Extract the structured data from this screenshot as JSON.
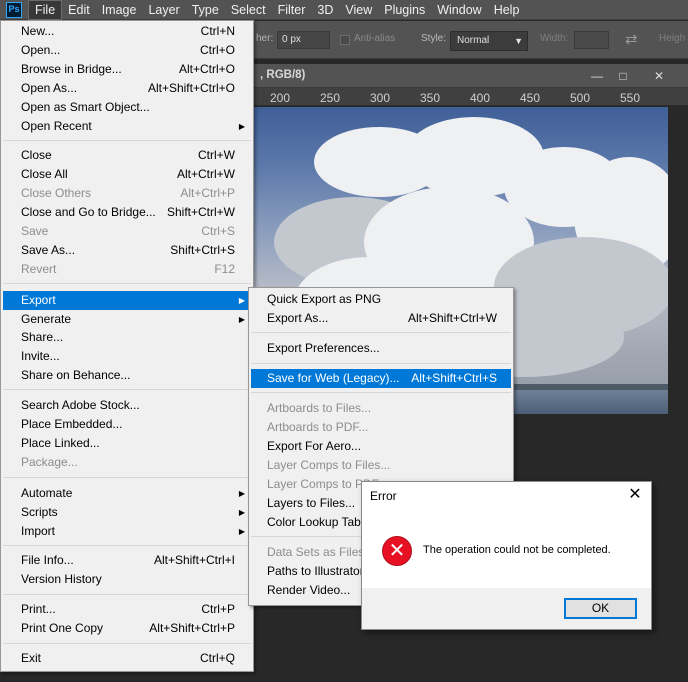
{
  "menubar": {
    "logo": "Ps",
    "items": [
      {
        "label": "File",
        "active": true
      },
      {
        "label": "Edit"
      },
      {
        "label": "Image"
      },
      {
        "label": "Layer"
      },
      {
        "label": "Type"
      },
      {
        "label": "Select"
      },
      {
        "label": "Filter"
      },
      {
        "label": "3D"
      },
      {
        "label": "View"
      },
      {
        "label": "Plugins"
      },
      {
        "label": "Window"
      },
      {
        "label": "Help"
      }
    ]
  },
  "options_bar": {
    "feather_label": "her:",
    "feather_value": "0 px",
    "antialias_label": "Anti-alias",
    "style_label": "Style:",
    "style_value": "Normal",
    "width_label": "Width:",
    "height_label": "Heigh"
  },
  "document": {
    "title_fragment": ", RGB/8)",
    "ruler_ticks": [
      "200",
      "250",
      "300",
      "350",
      "400",
      "450",
      "500",
      "550"
    ]
  },
  "file_menu": {
    "items": [
      {
        "label": "New...",
        "shortcut": "Ctrl+N"
      },
      {
        "label": "Open...",
        "shortcut": "Ctrl+O"
      },
      {
        "label": "Browse in Bridge...",
        "shortcut": "Alt+Ctrl+O"
      },
      {
        "label": "Open As...",
        "shortcut": "Alt+Shift+Ctrl+O"
      },
      {
        "label": "Open as Smart Object...",
        "shortcut": ""
      },
      {
        "label": "Open Recent",
        "shortcut": "",
        "submenu": true
      },
      {
        "label": "Close",
        "shortcut": "Ctrl+W"
      },
      {
        "label": "Close All",
        "shortcut": "Alt+Ctrl+W"
      },
      {
        "label": "Close Others",
        "shortcut": "Alt+Ctrl+P",
        "disabled": true
      },
      {
        "label": "Close and Go to Bridge...",
        "shortcut": "Shift+Ctrl+W"
      },
      {
        "label": "Save",
        "shortcut": "Ctrl+S",
        "disabled": true
      },
      {
        "label": "Save As...",
        "shortcut": "Shift+Ctrl+S"
      },
      {
        "label": "Revert",
        "shortcut": "F12",
        "disabled": true
      },
      {
        "label": "Export",
        "shortcut": "",
        "submenu": true,
        "highlighted": true
      },
      {
        "label": "Generate",
        "shortcut": "",
        "submenu": true
      },
      {
        "label": "Share...",
        "shortcut": ""
      },
      {
        "label": "Invite...",
        "shortcut": ""
      },
      {
        "label": "Share on Behance...",
        "shortcut": ""
      },
      {
        "label": "Search Adobe Stock...",
        "shortcut": ""
      },
      {
        "label": "Place Embedded...",
        "shortcut": ""
      },
      {
        "label": "Place Linked...",
        "shortcut": ""
      },
      {
        "label": "Package...",
        "shortcut": "",
        "disabled": true
      },
      {
        "label": "Automate",
        "shortcut": "",
        "submenu": true
      },
      {
        "label": "Scripts",
        "shortcut": "",
        "submenu": true
      },
      {
        "label": "Import",
        "shortcut": "",
        "submenu": true
      },
      {
        "label": "File Info...",
        "shortcut": "Alt+Shift+Ctrl+I"
      },
      {
        "label": "Version History",
        "shortcut": ""
      },
      {
        "label": "Print...",
        "shortcut": "Ctrl+P"
      },
      {
        "label": "Print One Copy",
        "shortcut": "Alt+Shift+Ctrl+P"
      },
      {
        "label": "Exit",
        "shortcut": "Ctrl+Q"
      }
    ]
  },
  "export_menu": {
    "items": [
      {
        "label": "Quick Export as PNG",
        "shortcut": ""
      },
      {
        "label": "Export As...",
        "shortcut": "Alt+Shift+Ctrl+W"
      },
      {
        "label": "Export Preferences...",
        "shortcut": ""
      },
      {
        "label": "Save for Web (Legacy)...",
        "shortcut": "Alt+Shift+Ctrl+S",
        "highlighted": true
      },
      {
        "label": "Artboards to Files...",
        "shortcut": "",
        "disabled": true
      },
      {
        "label": "Artboards to PDF...",
        "shortcut": "",
        "disabled": true
      },
      {
        "label": "Export For Aero...",
        "shortcut": ""
      },
      {
        "label": "Layer Comps to Files...",
        "shortcut": "",
        "disabled": true
      },
      {
        "label": "Layer Comps to PDF...",
        "shortcut": "",
        "disabled": true
      },
      {
        "label": "Layers to Files...",
        "shortcut": ""
      },
      {
        "label": "Color Lookup Tables...",
        "shortcut": ""
      },
      {
        "label": "Data Sets as Files...",
        "shortcut": "",
        "disabled": true
      },
      {
        "label": "Paths to Illustrator...",
        "shortcut": ""
      },
      {
        "label": "Render Video...",
        "shortcut": ""
      }
    ]
  },
  "error_dialog": {
    "title": "Error",
    "message": "The operation could not be completed.",
    "ok_label": "OK",
    "close_glyph": "✕",
    "icon_glyph": "✕"
  },
  "colors": {
    "highlight": "#0078d7",
    "menu_bg": "#f0f0f0",
    "error_red": "#e81123",
    "app_bg": "#535353"
  }
}
